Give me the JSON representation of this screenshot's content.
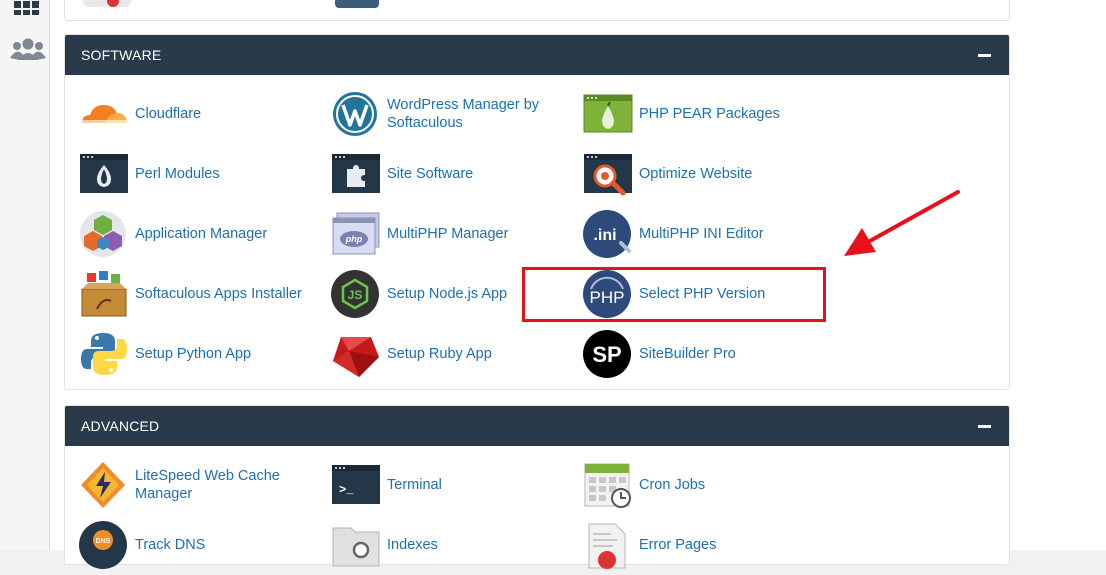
{
  "sidebar": {
    "items": [
      {
        "icon": "grid-icon"
      },
      {
        "icon": "users-icon"
      }
    ]
  },
  "software": {
    "title": "SOFTWARE",
    "items": [
      {
        "label": "Cloudflare",
        "icon": "cloudflare-icon"
      },
      {
        "label": "WordPress Manager by Softaculous",
        "icon": "wordpress-icon"
      },
      {
        "label": "PHP PEAR Packages",
        "icon": "php-pear-icon"
      },
      {
        "label": "Perl Modules",
        "icon": "perl-icon"
      },
      {
        "label": "Site Software",
        "icon": "site-software-icon"
      },
      {
        "label": "Optimize Website",
        "icon": "optimize-website-icon"
      },
      {
        "label": "Application Manager",
        "icon": "application-manager-icon"
      },
      {
        "label": "MultiPHP Manager",
        "icon": "multiphp-manager-icon"
      },
      {
        "label": "MultiPHP INI Editor",
        "icon": "multiphp-ini-icon"
      },
      {
        "label": "Softaculous Apps Installer",
        "icon": "softaculous-icon"
      },
      {
        "label": "Setup Node.js App",
        "icon": "nodejs-icon"
      },
      {
        "label": "Select PHP Version",
        "icon": "select-php-icon"
      },
      {
        "label": "Setup Python App",
        "icon": "python-icon"
      },
      {
        "label": "Setup Ruby App",
        "icon": "ruby-icon"
      },
      {
        "label": "SiteBuilder Pro",
        "icon": "sitebuilder-icon"
      }
    ]
  },
  "advanced": {
    "title": "ADVANCED",
    "items": [
      {
        "label": "LiteSpeed Web Cache Manager",
        "icon": "litespeed-icon"
      },
      {
        "label": "Terminal",
        "icon": "terminal-icon"
      },
      {
        "label": "Cron Jobs",
        "icon": "cron-jobs-icon"
      },
      {
        "label": "Track DNS",
        "icon": "track-dns-icon"
      },
      {
        "label": "Indexes",
        "icon": "indexes-icon"
      },
      {
        "label": "Error Pages",
        "icon": "error-pages-icon"
      }
    ]
  },
  "icon_text": {
    "php": "php",
    "ini": ".ini",
    "php_big": "PHP",
    "js": "JS",
    "sp": "SP",
    "dns": "DNS",
    "prompt": ">_"
  },
  "colors": {
    "header_bg": "#293a4a",
    "link": "#1d6fb0",
    "highlight": "#e8101a"
  }
}
